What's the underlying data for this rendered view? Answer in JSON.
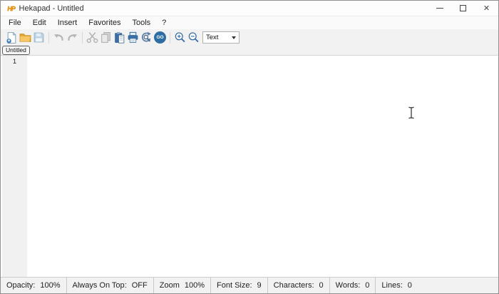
{
  "window": {
    "title": "Hekapad - Untitled",
    "app_icon_letters": "HP",
    "close_glyph": "✕"
  },
  "menu": {
    "items": [
      "File",
      "Edit",
      "Insert",
      "Favorites",
      "Tools",
      "?"
    ]
  },
  "toolbar": {
    "go_label": "GO",
    "format_value": "Text"
  },
  "tabs": [
    {
      "label": "Untitled"
    }
  ],
  "editor": {
    "line_numbers": [
      "1"
    ]
  },
  "status_bar": {
    "items": [
      {
        "label": "Opacity:",
        "value": "100%"
      },
      {
        "label": "Always On Top:",
        "value": "OFF"
      },
      {
        "label": "Zoom",
        "value": "100%"
      },
      {
        "label": "Font Size:",
        "value": "9"
      },
      {
        "label": "Characters:",
        "value": "0"
      },
      {
        "label": "Words:",
        "value": "0"
      },
      {
        "label": "Lines:",
        "value": "0"
      }
    ]
  },
  "colors": {
    "accent_blue": "#3a6ea5",
    "go_button_blue": "#2e6da4",
    "folder_amber": "#f3b33d",
    "disabled_gray": "#b5b5b5"
  }
}
